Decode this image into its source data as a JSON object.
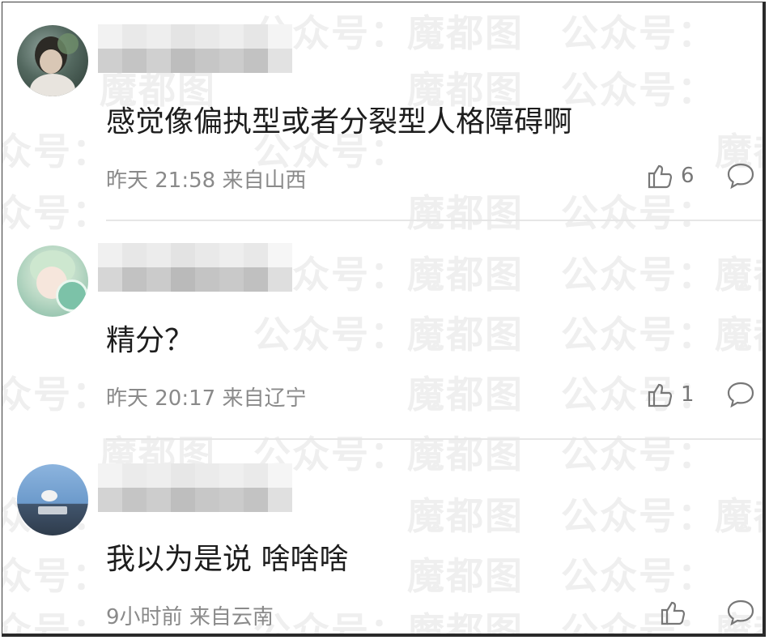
{
  "watermark": {
    "text": "魔都图　公众号："
  },
  "comments": [
    {
      "text": "感觉像偏执型或者分裂型人格障碍啊",
      "time": "昨天 21:58",
      "location": "来自山西",
      "likes": "6"
    },
    {
      "text": "精分？",
      "time": "昨天 20:17",
      "location": "来自辽宁",
      "likes": "1"
    },
    {
      "text": "我以为是说 啥啥啥",
      "time": "9小时前",
      "location": "来自云南",
      "likes": ""
    }
  ],
  "icons": {
    "like": "thumbs-up-icon",
    "reply": "comment-bubble-icon"
  },
  "colors": {
    "text": "#1d1d1d",
    "meta": "#8a8a8a",
    "icon": "#777777"
  }
}
